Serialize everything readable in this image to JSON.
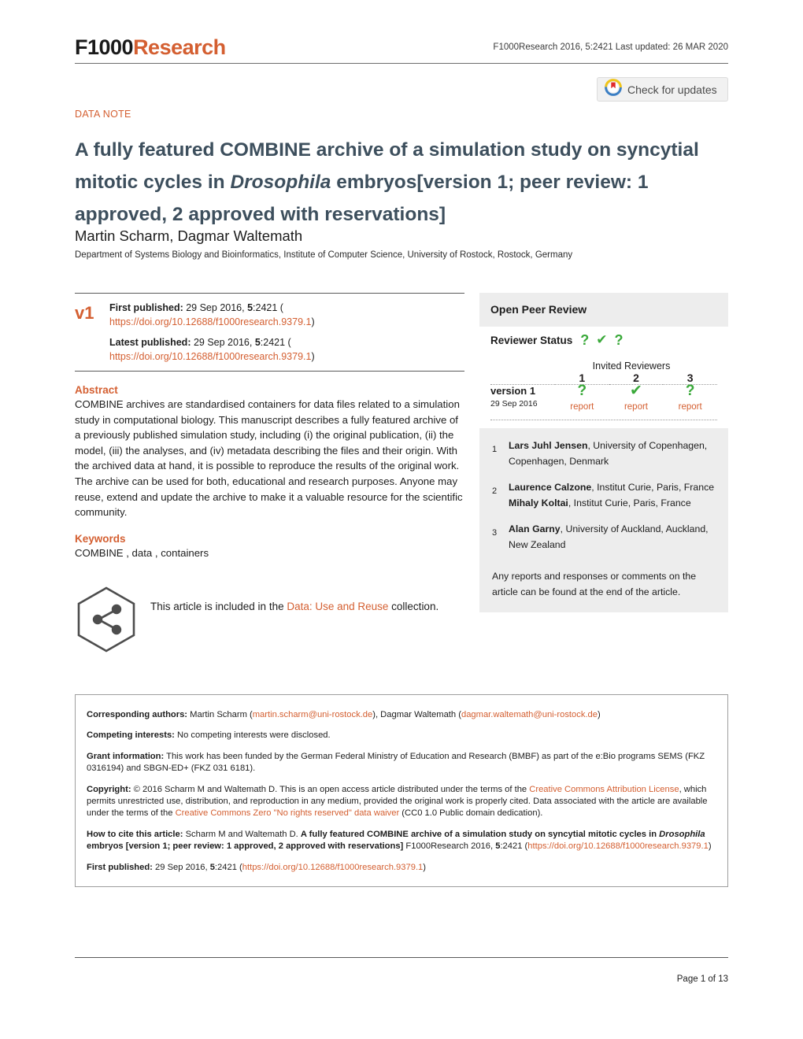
{
  "masthead": {
    "logo_f1000": "F1000",
    "logo_research": "Research",
    "meta": "F1000Research 2016, 5:2421 Last updated: 26 MAR 2020"
  },
  "updates_badge": {
    "label": "Check for updates",
    "icon": "check-for-updates-icon"
  },
  "article": {
    "type_label": "DATA NOTE",
    "title_part1": "A fully featured COMBINE archive of a simulation study on syncytial mitotic cycles in ",
    "title_italic": "Drosophila",
    "title_part2": " embryos",
    "title_part3": "[version 1; peer review: 1 approved, 2 approved with reservations]",
    "authors": "Martin Scharm, Dagmar Waltemath",
    "affiliation": "Department of Systems Biology and Bioinformatics, Institute of Computer Science, University of Rostock, Rostock, Germany"
  },
  "publication": {
    "version_badge": "v1",
    "first_published_label": "First published:",
    "first_published_value": " 29 Sep 2016, ",
    "first_published_vol": "5",
    "first_published_issue": ":2421 (",
    "first_published_doi": "https://doi.org/10.12688/f1000research.9379.1",
    "first_published_close": ")",
    "latest_published_label": "Latest published:",
    "latest_published_value": " 29 Sep 2016, ",
    "latest_published_vol": "5",
    "latest_published_issue": ":2421 (",
    "latest_published_doi": "https://doi.org/10.12688/f1000research.9379.1",
    "latest_published_close": ")"
  },
  "abstract": {
    "heading": "Abstract",
    "body": "COMBINE archives are standardised containers for data files related to a simulation study in computational biology. This manuscript describes a fully featured archive of a previously published simulation study, including (i) the original publication, (ii) the model, (iii) the analyses, and (iv) metadata describing the files and their origin. With the archived data at hand, it is possible to reproduce the results of the original work. The archive can be used for both, educational and research purposes. Anyone may reuse, extend and update the archive to make it a valuable resource for the scientific community."
  },
  "keywords": {
    "heading": "Keywords",
    "body": "COMBINE , data , containers"
  },
  "collection": {
    "icon": "share-network-hexagon-icon",
    "prefix": "This article is included in the ",
    "link": "Data: Use and Reuse",
    "suffix": " collection."
  },
  "open_peer_review": {
    "heading": "Open Peer Review",
    "status_label": "Reviewer Status",
    "status_icons": [
      "question-mark-icon",
      "check-mark-icon",
      "question-mark-icon"
    ],
    "invited_reviewers_label": "Invited Reviewers",
    "columns": [
      "1",
      "2",
      "3"
    ],
    "rows": [
      {
        "version": "version 1",
        "date": "29 Sep 2016",
        "cells": [
          {
            "icon": "question-mark-icon",
            "link": "report"
          },
          {
            "icon": "check-mark-icon",
            "link": "report"
          },
          {
            "icon": "question-mark-icon",
            "link": "report"
          }
        ]
      }
    ],
    "reviewers": [
      {
        "num": "1",
        "name": "Lars Juhl Jensen",
        "affiliation": ", University of Copenhagen, Copenhagen, Denmark",
        "name2": "",
        "affiliation2": ""
      },
      {
        "num": "2",
        "name": "Laurence Calzone",
        "affiliation": ", Institut Curie, Paris, France",
        "name2": "Mihaly Koltai",
        "affiliation2": ", Institut Curie, Paris, France"
      },
      {
        "num": "3",
        "name": "Alan Garny",
        "affiliation": ", University of Auckland, Auckland, New Zealand",
        "name2": "",
        "affiliation2": ""
      }
    ],
    "footnote": "Any reports and responses or comments on the article can be found at the end of the article."
  },
  "info_box": {
    "corresponding_label": "Corresponding authors:",
    "corresponding_text1": " Martin Scharm (",
    "corresponding_email1": "martin.scharm@uni-rostock.de",
    "corresponding_text2": "), Dagmar Waltemath (",
    "corresponding_email2": "dagmar.waltemath@uni-rostock.de",
    "corresponding_text3": ")",
    "competing_label": "Competing interests:",
    "competing_text": " No competing interests were disclosed.",
    "grant_label": "Grant information:",
    "grant_text": " This work has been funded by the German Federal Ministry of Education and Research (BMBF) as part of the e:Bio programs SEMS (FKZ 0316194) and SBGN-ED+ (FKZ 031 6181).",
    "copyright_label": "Copyright:",
    "copyright_text1": " © 2016 Scharm M and Waltemath D. This is an open access article distributed under the terms of the ",
    "copyright_link1": "Creative Commons Attribution License",
    "copyright_text2": ", which permits unrestricted use, distribution, and reproduction in any medium, provided the original work is properly cited. Data associated with the article are available under the terms of the ",
    "copyright_link2": "Creative Commons Zero \"No rights reserved\" data waiver",
    "copyright_text3": " (CC0 1.0 Public domain dedication).",
    "cite_label": "How to cite this article:",
    "cite_text1": " Scharm M and Waltemath D. ",
    "cite_title1": "A fully featured COMBINE archive of a simulation study on syncytial mitotic cycles in ",
    "cite_title_italic": "Drosophila",
    "cite_title2": " embryos [version 1; peer review: 1 approved, 2 approved with reservations]",
    "cite_text2": " F1000Research 2016, ",
    "cite_vol": "5",
    "cite_issue": ":2421 (",
    "cite_doi": "https://doi.org/10.12688/f1000research.9379.1",
    "cite_close": ")",
    "firstpub_label": "First published:",
    "firstpub_text": " 29 Sep 2016, ",
    "firstpub_vol": "5",
    "firstpub_issue": ":2421 (",
    "firstpub_doi": "https://doi.org/10.12688/f1000research.9379.1",
    "firstpub_close": ")"
  },
  "footer": {
    "page_number": "Page 1 of 13"
  },
  "colors": {
    "accent_orange": "#d45f31",
    "title_slate": "#3d4f5d",
    "approved_green": "#3aa93a",
    "panel_gray": "#ededed"
  }
}
